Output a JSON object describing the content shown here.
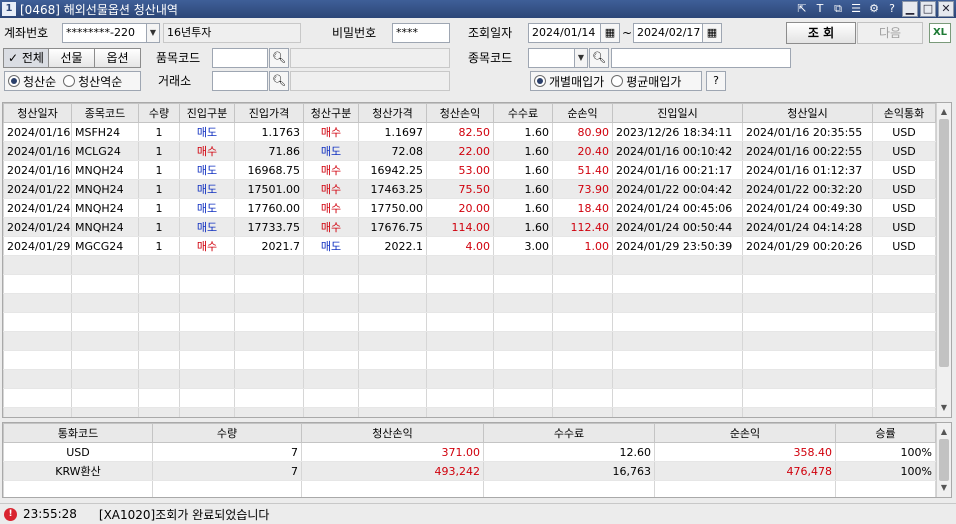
{
  "window": {
    "app_badge": "1",
    "title": "[0468] 해외선물옵션 청산내역",
    "icons": [
      "link-icon",
      "text-icon",
      "copy-icon",
      "list-icon",
      "settings-icon",
      "help-icon",
      "minimize-icon",
      "maximize-icon",
      "close-icon"
    ],
    "icon_glyphs": [
      "⇱",
      "T",
      "⧉",
      "☰",
      "⚙",
      "?",
      "▁",
      "□",
      "✕"
    ]
  },
  "form": {
    "account_label": "계좌번호",
    "account_value": "********-220",
    "account_name": "16년투자",
    "password_label": "비밀번호",
    "password_value": "****",
    "date_label": "조회일자",
    "date_from": "2024/01/14",
    "date_sep": "~",
    "date_to": "2024/02/17",
    "search_button": "조 회",
    "next_button": "다음",
    "excel_label": "XL",
    "seg_all": "✓ 전체",
    "seg_futures": "선물",
    "seg_options": "옵션",
    "product_label": "품목코드",
    "product_value": "",
    "symbol_label": "종목코드",
    "symbol_value": "",
    "exchange_label": "거래소",
    "exchange_value": "",
    "sort_radio_1": "청산순",
    "sort_radio_2": "청산역순",
    "price_radio_1": "개별매입가",
    "price_radio_2": "평균매입가",
    "help_button": "?"
  },
  "grid": {
    "columns": [
      "청산일자",
      "종목코드",
      "수량",
      "진입구분",
      "진입가격",
      "청산구분",
      "청산가격",
      "청산손익",
      "수수료",
      "순손익",
      "진입일시",
      "청산일시",
      "손익통화"
    ],
    "rows": [
      [
        "2024/01/16",
        "MSFH24",
        "1",
        "매도",
        "1.1763",
        "매수",
        "1.1697",
        "82.50",
        "1.60",
        "80.90",
        "2023/12/26  18:34:11",
        "2024/01/16  20:35:55",
        "USD"
      ],
      [
        "2024/01/16",
        "MCLG24",
        "1",
        "매수",
        "71.86",
        "매도",
        "72.08",
        "22.00",
        "1.60",
        "20.40",
        "2024/01/16  00:10:42",
        "2024/01/16  00:22:55",
        "USD"
      ],
      [
        "2024/01/16",
        "MNQH24",
        "1",
        "매도",
        "16968.75",
        "매수",
        "16942.25",
        "53.00",
        "1.60",
        "51.40",
        "2024/01/16  00:21:17",
        "2024/01/16  01:12:37",
        "USD"
      ],
      [
        "2024/01/22",
        "MNQH24",
        "1",
        "매도",
        "17501.00",
        "매수",
        "17463.25",
        "75.50",
        "1.60",
        "73.90",
        "2024/01/22  00:04:42",
        "2024/01/22  00:32:20",
        "USD"
      ],
      [
        "2024/01/24",
        "MNQH24",
        "1",
        "매도",
        "17760.00",
        "매수",
        "17750.00",
        "20.00",
        "1.60",
        "18.40",
        "2024/01/24  00:45:06",
        "2024/01/24  00:49:30",
        "USD"
      ],
      [
        "2024/01/24",
        "MNQH24",
        "1",
        "매도",
        "17733.75",
        "매수",
        "17676.75",
        "114.00",
        "1.60",
        "112.40",
        "2024/01/24  00:50:44",
        "2024/01/24  04:14:28",
        "USD"
      ],
      [
        "2024/01/29",
        "MGCG24",
        "1",
        "매수",
        "2021.7",
        "매도",
        "2022.1",
        "4.00",
        "3.00",
        "1.00",
        "2024/01/29  23:50:39",
        "2024/01/29  00:20:26",
        "USD"
      ]
    ],
    "empty_rows": 9,
    "buy_color": "#d0000c",
    "sell_color": "#1030c0"
  },
  "summary": {
    "columns": [
      "통화코드",
      "수량",
      "청산손익",
      "수수료",
      "순손익",
      "승률"
    ],
    "rows": [
      [
        "USD",
        "7",
        "371.00",
        "12.60",
        "358.40",
        "100%"
      ],
      [
        "KRW환산",
        "7",
        "493,242",
        "16,763",
        "476,478",
        "100%"
      ]
    ]
  },
  "status": {
    "time": "23:55:28",
    "message": "[XA1020]조회가 완료되었습니다"
  }
}
